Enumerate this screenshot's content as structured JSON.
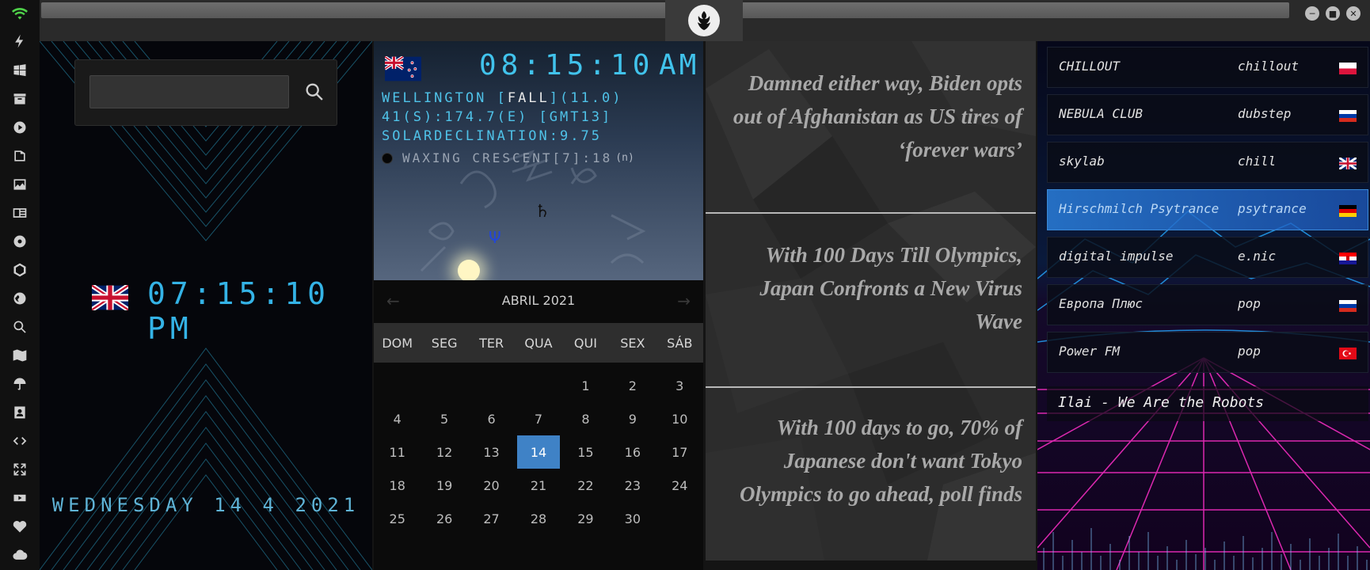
{
  "colors": {
    "clock_blue": "#34b3e6",
    "calendar_today": "#3f82c6",
    "news_text": "#a9a9a9",
    "radio_active": "#2878d2"
  },
  "sidebar": {
    "icons": [
      "wifi-icon",
      "lightning-icon",
      "windows-icon",
      "archive-icon",
      "play-icon",
      "map-book-icon",
      "image-icon",
      "news-icon",
      "atom-icon",
      "hexagon-icon",
      "globe-icon",
      "search-icon",
      "map-icon",
      "umbrella-icon",
      "contacts-icon",
      "code-icon",
      "expand-icon",
      "youtube-icon",
      "heart-icon",
      "cloud-icon"
    ]
  },
  "world_clock": {
    "search": {
      "value": "",
      "placeholder": ""
    },
    "time": "07:15:10 PM",
    "date": "WEDNESDAY 14 4 2021"
  },
  "nz_clock": {
    "time": "08:15:10",
    "ampm": "AM",
    "location_prefix": "WELLINGTON [",
    "location_season": "FALL",
    "location_suffix": "](11.0)",
    "coords": "41(S):174.7(E) [GMT13]",
    "declination": "SOLARDECLINATION:9.75",
    "moon_phase": "WAXING CRESCENT[7]:18",
    "moon_suffix": "(n)",
    "saturn_symbol": "♄",
    "neptune_symbol": "Ψ"
  },
  "calendar": {
    "month_label": "ABRIL 2021",
    "prev": "←",
    "next": "→",
    "weekdays": [
      "DOM",
      "SEG",
      "TER",
      "QUA",
      "QUI",
      "SEX",
      "SÁB"
    ],
    "weeks": [
      [
        "",
        "",
        "",
        "",
        "1",
        "2",
        "3"
      ],
      [
        "4",
        "5",
        "6",
        "7",
        "8",
        "9",
        "10"
      ],
      [
        "11",
        "12",
        "13",
        "14",
        "15",
        "16",
        "17"
      ],
      [
        "18",
        "19",
        "20",
        "21",
        "22",
        "23",
        "24"
      ],
      [
        "25",
        "26",
        "27",
        "28",
        "29",
        "30",
        ""
      ]
    ],
    "today": "14"
  },
  "news": [
    {
      "headline": "Damned either way, Biden opts out of Afghanistan as US tires of ‘forever wars’"
    },
    {
      "headline": "With 100 Days Till Olympics, Japan Confronts a New Virus Wave"
    },
    {
      "headline": "With 100 days to go, 70% of Japanese don't want Tokyo Olympics to go ahead, poll finds"
    }
  ],
  "radio": {
    "stations": [
      {
        "name": "CHILLOUT",
        "genre": "chillout",
        "flag": "poland-flag"
      },
      {
        "name": "NEBULA CLUB",
        "genre": "dubstep",
        "flag": "russia-flag"
      },
      {
        "name": "skylab",
        "genre": "chill",
        "flag": "uk-flag"
      },
      {
        "name": "Hirschmilch Psytrance",
        "genre": "psytrance",
        "flag": "germany-flag",
        "active": true
      },
      {
        "name": "digital impulse",
        "genre": "e.nic",
        "flag": "croatia-flag"
      },
      {
        "name": "Европа Плюс",
        "genre": "pop",
        "flag": "russia-flag"
      },
      {
        "name": "Power FM",
        "genre": "pop",
        "flag": "turkey-flag"
      }
    ],
    "now_playing": "Ilai - We Are the Robots"
  }
}
